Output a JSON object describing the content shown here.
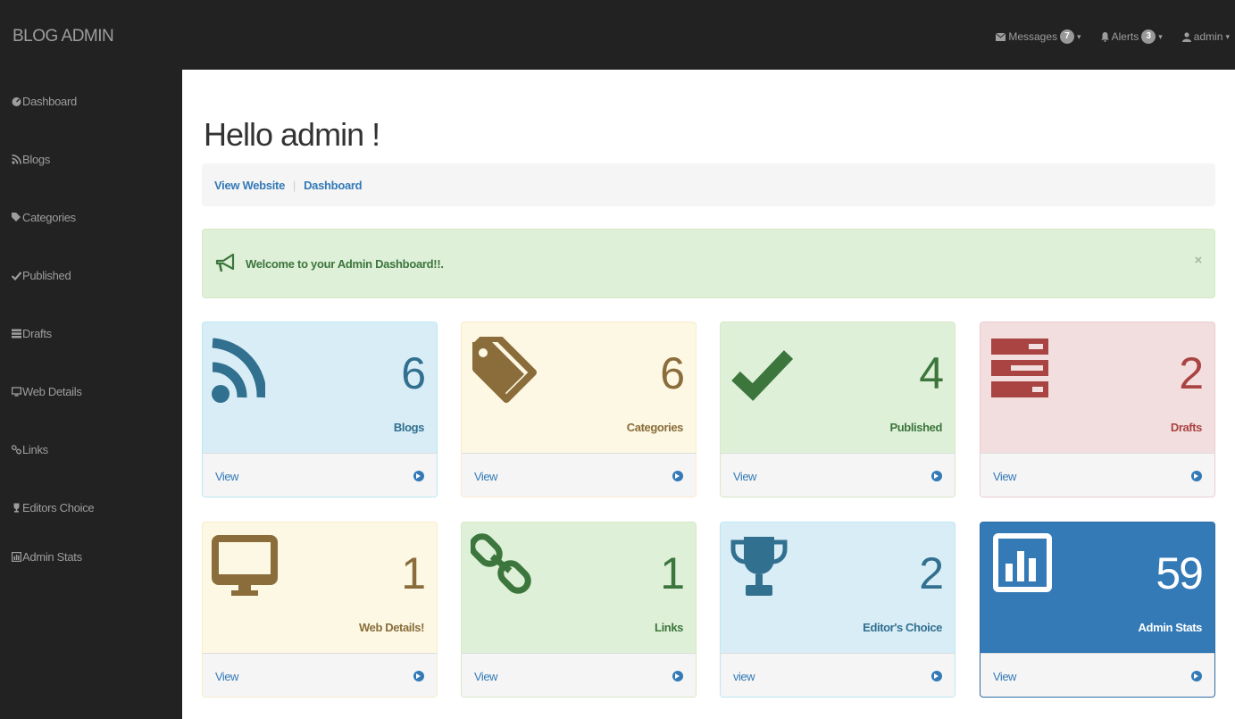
{
  "brand": "BLOG ADMIN",
  "topnav": {
    "messages_label": "Messages",
    "messages_count": "7",
    "alerts_label": "Alerts",
    "alerts_count": "3",
    "user_label": "admin"
  },
  "sidebar": {
    "items": [
      {
        "label": "Dashboard",
        "icon": "dashboard-icon"
      },
      {
        "label": "Blogs",
        "icon": "rss-icon"
      },
      {
        "label": "Categories",
        "icon": "tags-icon"
      },
      {
        "label": "Published",
        "icon": "check-icon"
      },
      {
        "label": "Drafts",
        "icon": "tasks-icon"
      },
      {
        "label": "Web Details",
        "icon": "desktop-icon"
      },
      {
        "label": "Links",
        "icon": "link-icon"
      },
      {
        "label": "Editors Choice",
        "icon": "trophy-icon"
      },
      {
        "label": "Admin Stats",
        "icon": "chart-icon"
      }
    ]
  },
  "page_title": "Hello admin !",
  "breadcrumb": {
    "item1": "View Website",
    "item2": "Dashboard"
  },
  "alert": {
    "text": "Welcome to your Admin Dashboard!!.",
    "close": "×"
  },
  "panels": [
    {
      "count": "6",
      "label": "Blogs",
      "footer": "View",
      "icon": "rss-icon",
      "style": "info"
    },
    {
      "count": "6",
      "label": "Categories",
      "footer": "View",
      "icon": "tags-icon",
      "style": "warning"
    },
    {
      "count": "4",
      "label": "Published",
      "footer": "View",
      "icon": "check-icon",
      "style": "success"
    },
    {
      "count": "2",
      "label": "Drafts",
      "footer": "View",
      "icon": "tasks-icon",
      "style": "danger"
    },
    {
      "count": "1",
      "label": "Web Details!",
      "footer": "View",
      "icon": "desktop-icon",
      "style": "warning"
    },
    {
      "count": "1",
      "label": "Links",
      "footer": "View",
      "icon": "link-icon",
      "style": "success"
    },
    {
      "count": "2",
      "label": "Editor's Choice",
      "footer": "view",
      "icon": "trophy-icon",
      "style": "info"
    },
    {
      "count": "59",
      "label": "Admin Stats",
      "footer": "View",
      "icon": "chart-icon",
      "style": "primary"
    }
  ],
  "colors": {
    "navbar": "#222222",
    "link": "#337ab7",
    "info_text": "#31708f",
    "warning_text": "#8a6d3b",
    "success_text": "#3c763d",
    "danger_text": "#a94442",
    "primary_bg": "#337ab7"
  }
}
